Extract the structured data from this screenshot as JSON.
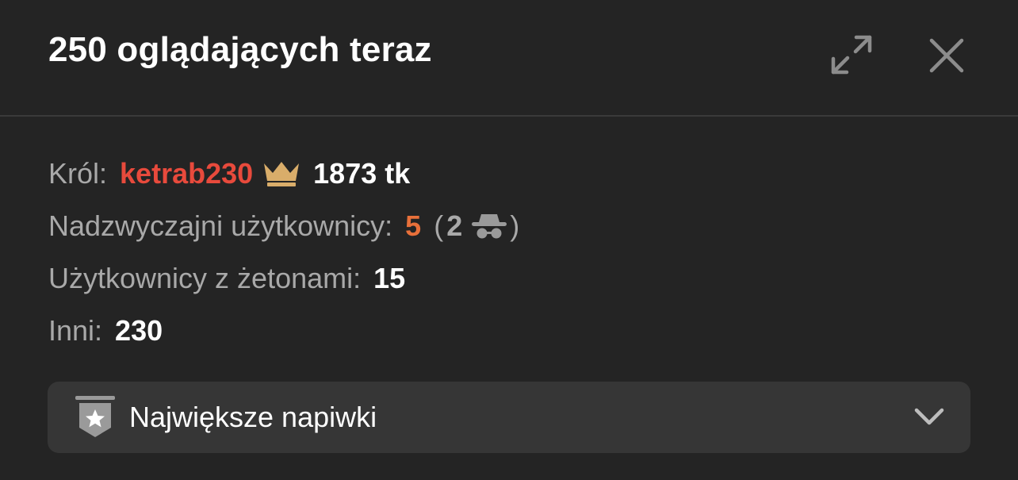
{
  "header": {
    "title": "250 oglądających teraz",
    "expand_icon": "expand-icon",
    "close_icon": "close-icon"
  },
  "stats": {
    "king": {
      "label": "Król:",
      "username": "ketrab230",
      "icon": "crown-icon",
      "tokens": "1873 tk"
    },
    "exceptional": {
      "label": "Nadzwyczajni użytkownicy:",
      "count": "5",
      "open_paren": "(",
      "anonymous_count": "2",
      "anonymous_icon": "incognito-icon",
      "close_paren": ")"
    },
    "with_tokens": {
      "label": "Użytkownicy z żetonami:",
      "count": "15"
    },
    "others": {
      "label": "Inni:",
      "count": "230"
    }
  },
  "dropdown": {
    "icon": "star-badge-icon",
    "label": "Największe napiwki",
    "chevron": "chevron-down-icon"
  },
  "colors": {
    "background": "#242424",
    "king_name": "#e84a3c",
    "exceptional_count": "#e8703a",
    "crown": "#d9ad6a",
    "muted_text": "#a9a9a9",
    "dropdown_bg": "#363636"
  }
}
